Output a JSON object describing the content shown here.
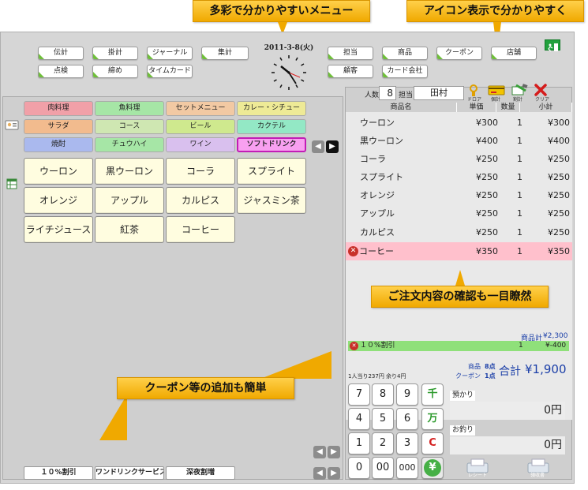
{
  "callouts": {
    "top_left": "多彩で分かりやすいメニュー",
    "top_right": "アイコン表示で分かりやすく",
    "order": "ご注文内容の確認も一目瞭然",
    "coupon": "クーポン等の追加も簡単"
  },
  "clock": {
    "date": "2011-3-8(火)"
  },
  "top_buttons": {
    "row1": [
      "伝計",
      "掛計",
      "ジャーナル",
      "集計"
    ],
    "row2": [
      "点検",
      "締め",
      "タイムカード"
    ],
    "right_row1": [
      "担当",
      "商品",
      "クーポン",
      "店舗"
    ],
    "right_row2": [
      "顧客",
      "カード会社"
    ]
  },
  "categories": [
    {
      "label": "肉料理",
      "color": "#f1a0a8"
    },
    {
      "label": "魚料理",
      "color": "#a6e6a6"
    },
    {
      "label": "セットメニュー",
      "color": "#f2c9a3"
    },
    {
      "label": "カレー・シチュー",
      "color": "#eeea96"
    },
    {
      "label": "サラダ",
      "color": "#f2bb8e"
    },
    {
      "label": "コース",
      "color": "#cfe7b2"
    },
    {
      "label": "ビール",
      "color": "#cfe98e"
    },
    {
      "label": "カクテル",
      "color": "#93e8c5"
    },
    {
      "label": "焼酎",
      "color": "#aab9ee"
    },
    {
      "label": "チュウハイ",
      "color": "#a6e6a6"
    },
    {
      "label": "ワイン",
      "color": "#d9c0ee"
    },
    {
      "label": "ソフトドリンク",
      "color": "#f8a0f0"
    }
  ],
  "items": [
    "ウーロン",
    "黒ウーロン",
    "コーラ",
    "スプライト",
    "オレンジ",
    "アップル",
    "カルピス",
    "ジャスミン茶",
    "ライチジュース",
    "紅茶",
    "コーヒー"
  ],
  "coupons": [
    "１０%割引",
    "ワンドリンクサービス",
    "深夜割増"
  ],
  "header": {
    "guest_label": "人数",
    "guest_count": "8",
    "staff_label": "担当",
    "staff_name": "田村",
    "icons": [
      "ドロア",
      "個計",
      "割計",
      "クリア"
    ]
  },
  "order_table": {
    "columns": [
      "商品名",
      "単価",
      "数量",
      "小計"
    ],
    "rows": [
      {
        "name": "ウーロン",
        "price": "¥300",
        "qty": "1",
        "subtotal": "¥300"
      },
      {
        "name": "黒ウーロン",
        "price": "¥400",
        "qty": "1",
        "subtotal": "¥400"
      },
      {
        "name": "コーラ",
        "price": "¥250",
        "qty": "1",
        "subtotal": "¥250"
      },
      {
        "name": "スプライト",
        "price": "¥250",
        "qty": "1",
        "subtotal": "¥250"
      },
      {
        "name": "オレンジ",
        "price": "¥250",
        "qty": "1",
        "subtotal": "¥250"
      },
      {
        "name": "アップル",
        "price": "¥250",
        "qty": "1",
        "subtotal": "¥250"
      },
      {
        "name": "カルピス",
        "price": "¥250",
        "qty": "1",
        "subtotal": "¥250"
      },
      {
        "name": "コーヒー",
        "price": "¥350",
        "qty": "1",
        "subtotal": "¥350"
      }
    ]
  },
  "summary": {
    "item_total_label": "商品計",
    "item_total": "¥2,300",
    "discount_name": "１０%割引",
    "discount_qty": "1",
    "discount_value": "¥-400",
    "per_person": "1人当り237円 余り4円",
    "product_count_label": "商品",
    "product_count": "8点",
    "coupon_count_label": "クーポン",
    "coupon_count": "1点",
    "total_label": "合計",
    "total_value": "¥1,900"
  },
  "keypad": [
    "7",
    "8",
    "9",
    "千",
    "4",
    "5",
    "6",
    "万",
    "1",
    "2",
    "3",
    "C",
    "0",
    "00",
    "000",
    "¥"
  ],
  "payment": {
    "deposit_label": "預かり",
    "deposit_value": "0円",
    "change_label": "お釣り",
    "change_value": "0円",
    "receipt_label": "レシート",
    "bill_label": "領収書"
  }
}
